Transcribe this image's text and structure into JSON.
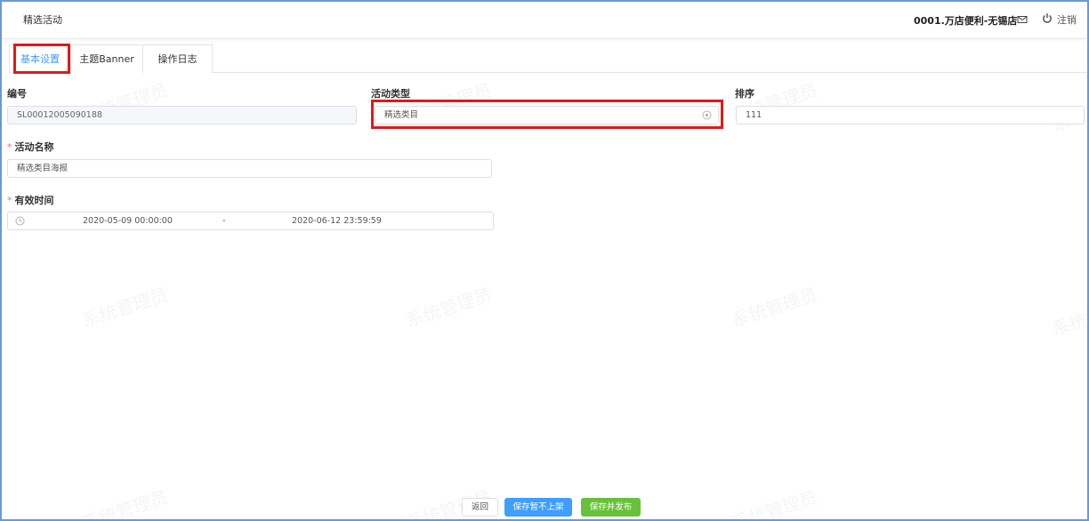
{
  "header": {
    "page_title": "精选活动",
    "store_name": "0001.万店便利-无锡店",
    "logout_label": "注销",
    "mail_icon": "mail-icon",
    "power_icon": "power-icon"
  },
  "tabs": [
    {
      "label": "基本设置",
      "active": true
    },
    {
      "label": "主题Banner",
      "active": false
    },
    {
      "label": "操作日志",
      "active": false
    }
  ],
  "form": {
    "code_label": "编号",
    "code_value": "SL00012005090188",
    "type_label": "活动类型",
    "type_value": "精选类目",
    "sort_label": "排序",
    "sort_value": "111",
    "name_required_mark": "*",
    "name_label": "活动名称",
    "name_value": "精选类目海报",
    "time_required_mark": "*",
    "time_label": "有效时间",
    "time_start": "2020-05-09 00:00:00",
    "time_separator": "-",
    "time_end": "2020-06-12 23:59:59"
  },
  "buttons": {
    "back_label": "返回",
    "save_label": "保存暂不上架",
    "publish_label": "保存并发布"
  },
  "watermark_text": "系统管理员",
  "colors": {
    "primary": "#409eff",
    "success": "#67c23a",
    "highlight": "#e01919",
    "frame": "#6a9ad6"
  }
}
